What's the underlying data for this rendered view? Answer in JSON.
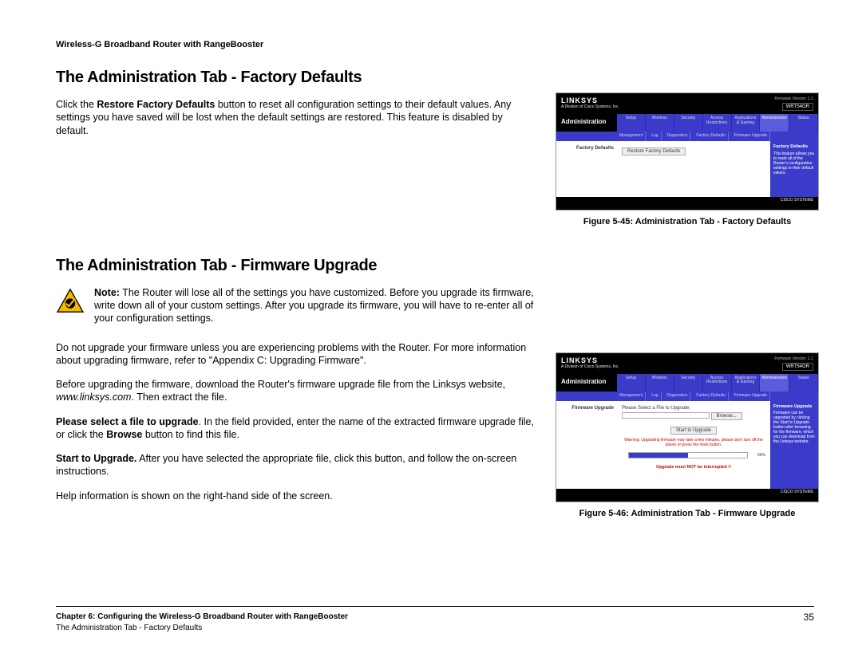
{
  "header": "Wireless-G Broadband Router with RangeBooster",
  "section1": {
    "title": "The Administration Tab - Factory Defaults",
    "para1_pre": "Click the ",
    "para1_bold": "Restore Factory Defaults",
    "para1_post": " button to reset all configuration settings to their default values. Any settings you have saved will be lost when the default settings are restored. This feature is disabled by default."
  },
  "fig1": {
    "caption": "Figure 5-45: Administration Tab - Factory Defaults",
    "brand": "LINKSYS",
    "brand_sub": "A Division of Cisco Systems, Inc.",
    "fw": "Firmware Version: 1.1",
    "model": "WRT54GR",
    "nav_label": "Administration",
    "tabs": [
      "Setup",
      "Wireless",
      "Security",
      "Access\nRestrictions",
      "Applications &\nGaming",
      "Administration",
      "Status"
    ],
    "subnav": [
      "Management",
      "Log",
      "Diagnostics",
      "Factory Defaults",
      "Firmware Upgrade"
    ],
    "side_label": "Factory Defaults",
    "button": "Restore Factory Defaults",
    "help_title": "Factory Defaults",
    "help_body": "This feature allows you to reset all of the Router's configuration settings to their default values.",
    "cisco": "CISCO SYSTEMS"
  },
  "section2": {
    "title": "The Administration Tab - Firmware Upgrade",
    "note_bold": "Note:",
    "note_text": " The Router will lose all of the settings you have customized. Before you upgrade its firmware, write down all of your custom settings. After you upgrade its firmware, you will have to re-enter all of your configuration settings.",
    "p2": "Do not upgrade your firmware unless you are experiencing problems with the Router. For more information about upgrading firmware, refer to \"Appendix C: Upgrading Firmware\".",
    "p3_a": "Before upgrading the firmware, download the Router's firmware upgrade file from the Linksys website, ",
    "p3_i": "www.linksys.com",
    "p3_b": ". Then extract the file.",
    "p4_b1": "Please select a file to upgrade",
    "p4_a": ". In the field provided, enter the name of the extracted firmware upgrade file, or click the ",
    "p4_b2": "Browse",
    "p4_c": " button to find this file.",
    "p5_b": "Start to Upgrade.",
    "p5_a": " After you have selected the appropriate file, click this button, and follow the on-screen instructions.",
    "p6": "Help information is shown on the right-hand side of the screen."
  },
  "fig2": {
    "caption": "Figure 5-46: Administration Tab - Firmware Upgrade",
    "side_label": "Firmware Upgrade",
    "mid_label": "Please Select a File to Upgrade:",
    "browse": "Browse...",
    "start": "Start to Upgrade",
    "warn1": "Warning: Upgrading firmware may take a few minutes, please don't turn off the power or press the reset button.",
    "pct": "50%",
    "warn2": "Upgrade must NOT be interrupted !!",
    "help_title": "Firmware Upgrade",
    "help_body": "Firmware can be upgraded by clicking the Start to Upgrade button after browsing for the firmware, which you can download from the Linksys website."
  },
  "footer": {
    "l1": "Chapter 6: Configuring the Wireless-G Broadband Router with RangeBooster",
    "l2": "The Administration Tab - Factory Defaults",
    "page": "35"
  }
}
